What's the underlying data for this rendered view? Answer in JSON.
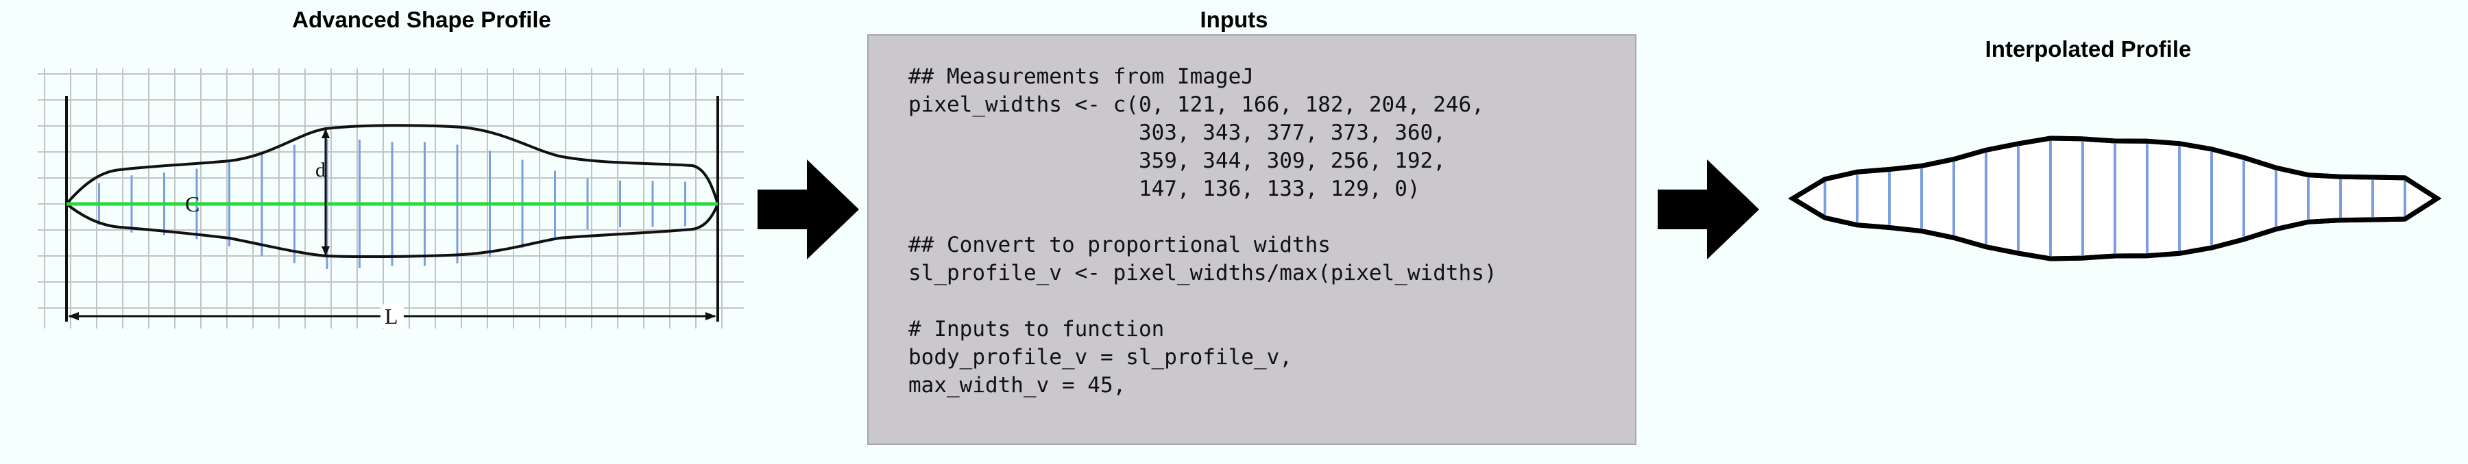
{
  "titles": {
    "left": "Advanced Shape Profile",
    "middle": "Inputs",
    "right": "Interpolated Profile"
  },
  "shape_figure": {
    "labels": {
      "circumference": "C",
      "depth": "d",
      "length": "L"
    },
    "colors": {
      "outline": "#111111",
      "width_lines": "#7a9ee0",
      "midline": "#22dd33",
      "grid": "#c4c4c4"
    }
  },
  "code": {
    "text": "## Measurements from ImageJ\npixel_widths <- c(0, 121, 166, 182, 204, 246,\n                  303, 343, 377, 373, 360,\n                  359, 344, 309, 256, 192,\n                  147, 136, 133, 129, 0)\n\n## Convert to proportional widths\nsl_profile_v <- pixel_widths/max(pixel_widths)\n\n# Inputs to function\nbody_profile_v = sl_profile_v,\nmax_width_v = 45,"
  },
  "profile": {
    "pixel_widths": [
      0,
      121,
      166,
      182,
      204,
      246,
      303,
      343,
      377,
      373,
      360,
      359,
      344,
      309,
      256,
      192,
      147,
      136,
      133,
      129,
      0
    ],
    "max_width": 45,
    "colors": {
      "outline": "#000000",
      "fill": "#ffffff",
      "width_lines": "#7a9ee0"
    }
  },
  "arrows": {
    "color": "#000000"
  }
}
